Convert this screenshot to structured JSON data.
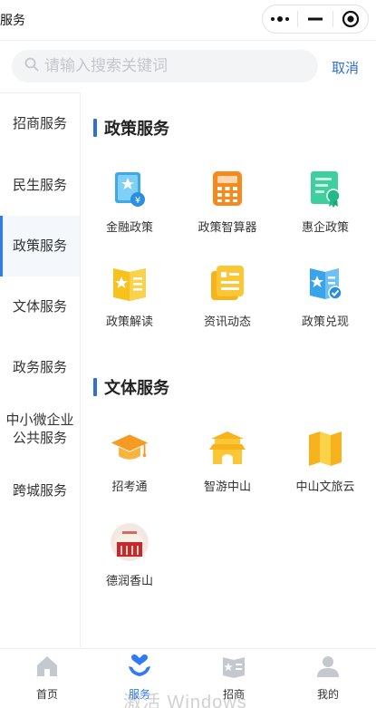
{
  "topbar": {
    "title": "服务",
    "capsule_icons": [
      "more-dots-icon",
      "minimize-icon",
      "target-icon"
    ]
  },
  "search": {
    "placeholder": "请输入搜索关键词",
    "cancel_label": "取消"
  },
  "sidebar": {
    "items": [
      {
        "label": "招商服务"
      },
      {
        "label": "民生服务"
      },
      {
        "label": "政策服务",
        "active": true
      },
      {
        "label": "文体服务"
      },
      {
        "label": "政务服务"
      },
      {
        "label": "中小微企业公共服务"
      },
      {
        "label": "跨城服务"
      }
    ],
    "item_lines": {
      "item5_line1": "中小微企业",
      "item5_line2": "公共服务"
    }
  },
  "sections": [
    {
      "title": "政策服务",
      "tiles": [
        {
          "label": "金融政策",
          "icon": "finance-policy-icon"
        },
        {
          "label": "政策智算器",
          "icon": "calculator-icon"
        },
        {
          "label": "惠企政策",
          "icon": "certificate-icon"
        },
        {
          "label": "政策解读",
          "icon": "book-star-icon"
        },
        {
          "label": "资讯动态",
          "icon": "news-card-icon"
        },
        {
          "label": "政策兑现",
          "icon": "policy-check-icon"
        }
      ]
    },
    {
      "title": "文体服务",
      "tiles": [
        {
          "label": "招考通",
          "icon": "graduation-cap-icon"
        },
        {
          "label": "智游中山",
          "icon": "gate-tower-icon"
        },
        {
          "label": "中山文旅云",
          "icon": "map-fold-icon"
        },
        {
          "label": "德润香山",
          "icon": "deruan-logo-icon"
        }
      ]
    }
  ],
  "tabbar": {
    "items": [
      {
        "label": "首页",
        "icon": "home-icon"
      },
      {
        "label": "服务",
        "icon": "service-heart-icon",
        "active": true
      },
      {
        "label": "招商",
        "icon": "merchant-book-icon"
      },
      {
        "label": "我的",
        "icon": "user-icon"
      }
    ]
  },
  "watermark": "激活 Windows",
  "colors": {
    "accent": "#2f7bf5",
    "section_bar": "#2f6fd6",
    "inactive_icon": "#c5c9cf"
  }
}
